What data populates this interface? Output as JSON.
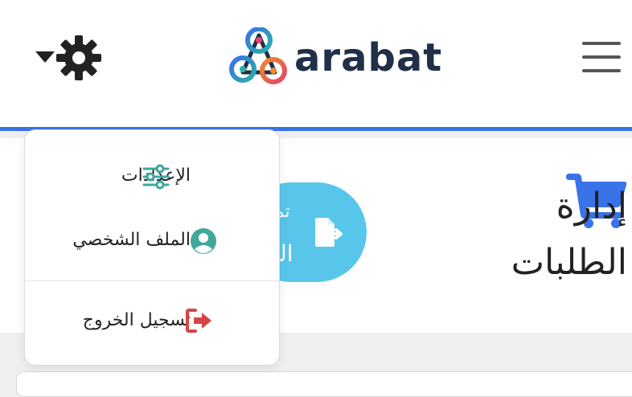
{
  "header": {
    "brand": "arabat",
    "accent_color": "#3a72e8"
  },
  "page": {
    "title_line1": "إدارة",
    "title_line2": "الطلبات",
    "action_text1": "تم",
    "action_text2": "الـ"
  },
  "dropdown": {
    "items": [
      {
        "label": "الإعدادات",
        "icon": "sliders-icon",
        "color": "#3fa79b"
      },
      {
        "label": "الملف الشخصي",
        "icon": "user-circle-icon",
        "color": "#3fa79b"
      },
      {
        "label": "تسجيل الخروج",
        "icon": "sign-out-icon",
        "color": "#d64545"
      }
    ]
  },
  "colors": {
    "cart": "#3a72e8",
    "action_pill": "#57c6ea"
  }
}
